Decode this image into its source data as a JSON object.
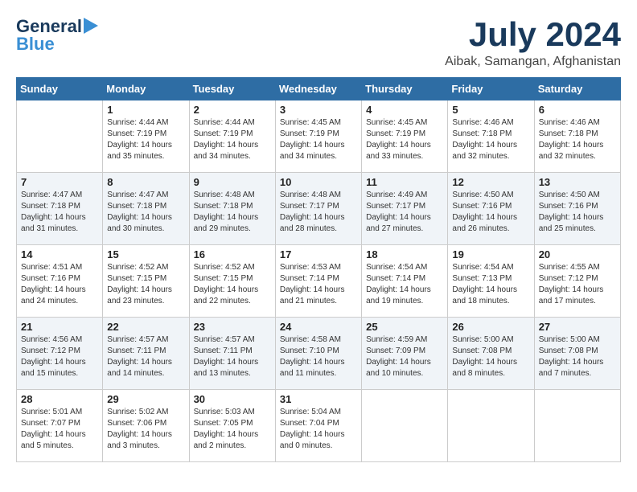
{
  "logo": {
    "general": "General",
    "blue": "Blue",
    "arrow": "►"
  },
  "title": {
    "month_year": "July 2024",
    "location": "Aibak, Samangan, Afghanistan"
  },
  "weekdays": [
    "Sunday",
    "Monday",
    "Tuesday",
    "Wednesday",
    "Thursday",
    "Friday",
    "Saturday"
  ],
  "weeks": [
    [
      {
        "day": "",
        "info": ""
      },
      {
        "day": "1",
        "info": "Sunrise: 4:44 AM\nSunset: 7:19 PM\nDaylight: 14 hours\nand 35 minutes."
      },
      {
        "day": "2",
        "info": "Sunrise: 4:44 AM\nSunset: 7:19 PM\nDaylight: 14 hours\nand 34 minutes."
      },
      {
        "day": "3",
        "info": "Sunrise: 4:45 AM\nSunset: 7:19 PM\nDaylight: 14 hours\nand 34 minutes."
      },
      {
        "day": "4",
        "info": "Sunrise: 4:45 AM\nSunset: 7:19 PM\nDaylight: 14 hours\nand 33 minutes."
      },
      {
        "day": "5",
        "info": "Sunrise: 4:46 AM\nSunset: 7:18 PM\nDaylight: 14 hours\nand 32 minutes."
      },
      {
        "day": "6",
        "info": "Sunrise: 4:46 AM\nSunset: 7:18 PM\nDaylight: 14 hours\nand 32 minutes."
      }
    ],
    [
      {
        "day": "7",
        "info": "Sunrise: 4:47 AM\nSunset: 7:18 PM\nDaylight: 14 hours\nand 31 minutes."
      },
      {
        "day": "8",
        "info": "Sunrise: 4:47 AM\nSunset: 7:18 PM\nDaylight: 14 hours\nand 30 minutes."
      },
      {
        "day": "9",
        "info": "Sunrise: 4:48 AM\nSunset: 7:18 PM\nDaylight: 14 hours\nand 29 minutes."
      },
      {
        "day": "10",
        "info": "Sunrise: 4:48 AM\nSunset: 7:17 PM\nDaylight: 14 hours\nand 28 minutes."
      },
      {
        "day": "11",
        "info": "Sunrise: 4:49 AM\nSunset: 7:17 PM\nDaylight: 14 hours\nand 27 minutes."
      },
      {
        "day": "12",
        "info": "Sunrise: 4:50 AM\nSunset: 7:16 PM\nDaylight: 14 hours\nand 26 minutes."
      },
      {
        "day": "13",
        "info": "Sunrise: 4:50 AM\nSunset: 7:16 PM\nDaylight: 14 hours\nand 25 minutes."
      }
    ],
    [
      {
        "day": "14",
        "info": "Sunrise: 4:51 AM\nSunset: 7:16 PM\nDaylight: 14 hours\nand 24 minutes."
      },
      {
        "day": "15",
        "info": "Sunrise: 4:52 AM\nSunset: 7:15 PM\nDaylight: 14 hours\nand 23 minutes."
      },
      {
        "day": "16",
        "info": "Sunrise: 4:52 AM\nSunset: 7:15 PM\nDaylight: 14 hours\nand 22 minutes."
      },
      {
        "day": "17",
        "info": "Sunrise: 4:53 AM\nSunset: 7:14 PM\nDaylight: 14 hours\nand 21 minutes."
      },
      {
        "day": "18",
        "info": "Sunrise: 4:54 AM\nSunset: 7:14 PM\nDaylight: 14 hours\nand 19 minutes."
      },
      {
        "day": "19",
        "info": "Sunrise: 4:54 AM\nSunset: 7:13 PM\nDaylight: 14 hours\nand 18 minutes."
      },
      {
        "day": "20",
        "info": "Sunrise: 4:55 AM\nSunset: 7:12 PM\nDaylight: 14 hours\nand 17 minutes."
      }
    ],
    [
      {
        "day": "21",
        "info": "Sunrise: 4:56 AM\nSunset: 7:12 PM\nDaylight: 14 hours\nand 15 minutes."
      },
      {
        "day": "22",
        "info": "Sunrise: 4:57 AM\nSunset: 7:11 PM\nDaylight: 14 hours\nand 14 minutes."
      },
      {
        "day": "23",
        "info": "Sunrise: 4:57 AM\nSunset: 7:11 PM\nDaylight: 14 hours\nand 13 minutes."
      },
      {
        "day": "24",
        "info": "Sunrise: 4:58 AM\nSunset: 7:10 PM\nDaylight: 14 hours\nand 11 minutes."
      },
      {
        "day": "25",
        "info": "Sunrise: 4:59 AM\nSunset: 7:09 PM\nDaylight: 14 hours\nand 10 minutes."
      },
      {
        "day": "26",
        "info": "Sunrise: 5:00 AM\nSunset: 7:08 PM\nDaylight: 14 hours\nand 8 minutes."
      },
      {
        "day": "27",
        "info": "Sunrise: 5:00 AM\nSunset: 7:08 PM\nDaylight: 14 hours\nand 7 minutes."
      }
    ],
    [
      {
        "day": "28",
        "info": "Sunrise: 5:01 AM\nSunset: 7:07 PM\nDaylight: 14 hours\nand 5 minutes."
      },
      {
        "day": "29",
        "info": "Sunrise: 5:02 AM\nSunset: 7:06 PM\nDaylight: 14 hours\nand 3 minutes."
      },
      {
        "day": "30",
        "info": "Sunrise: 5:03 AM\nSunset: 7:05 PM\nDaylight: 14 hours\nand 2 minutes."
      },
      {
        "day": "31",
        "info": "Sunrise: 5:04 AM\nSunset: 7:04 PM\nDaylight: 14 hours\nand 0 minutes."
      },
      {
        "day": "",
        "info": ""
      },
      {
        "day": "",
        "info": ""
      },
      {
        "day": "",
        "info": ""
      }
    ]
  ]
}
